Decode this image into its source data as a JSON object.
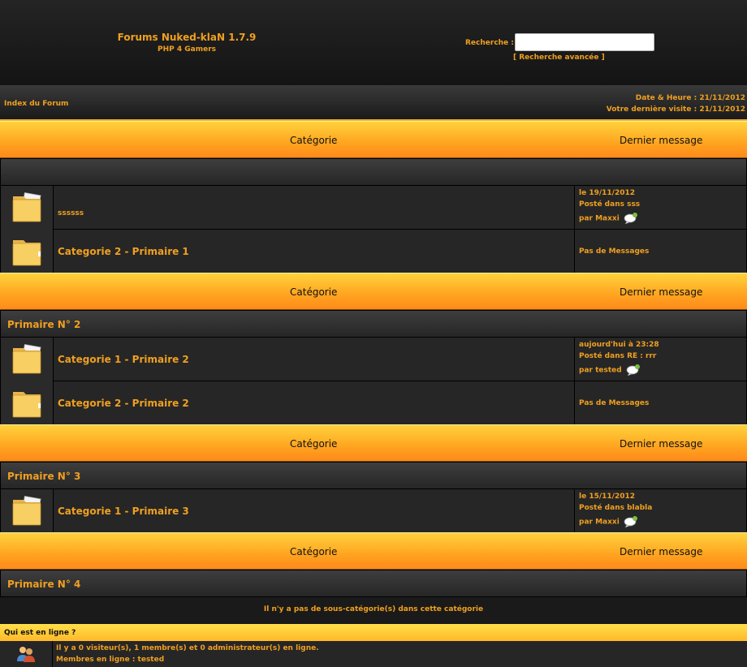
{
  "header": {
    "title": "Forums Nuked-klaN 1.7.9",
    "subtitle": "PHP 4 Gamers",
    "search_label": "Recherche :",
    "search_value": "",
    "advanced_search": "[ Recherche avancée ]"
  },
  "nav": {
    "index": "Index du Forum",
    "date": "Date & Heure : 21/11/2012",
    "last_visit": "Votre dernière visite : 21/11/2012"
  },
  "table_headers": {
    "category": "Catégorie",
    "last_message": "Dernier message"
  },
  "sections": [
    {
      "title": "",
      "forums": [
        {
          "name": "ssssss",
          "last": [
            "le 19/11/2012",
            "Posté dans sss",
            "par Maxxi"
          ],
          "has_bubble": true
        },
        {
          "name": "Categorie 2 - Primaire 1",
          "last": [
            "Pas de Messages"
          ],
          "has_bubble": false
        }
      ]
    },
    {
      "title": "Primaire N° 2",
      "forums": [
        {
          "name": "Categorie 1 - Primaire 2",
          "last": [
            "aujourd'hui à 23:28",
            "Posté dans RE : rrr",
            "par tested"
          ],
          "has_bubble": true
        },
        {
          "name": "Categorie 2 - Primaire 2",
          "last": [
            "Pas de Messages"
          ],
          "has_bubble": false
        }
      ]
    },
    {
      "title": "Primaire N° 3",
      "forums": [
        {
          "name": "Categorie 1 - Primaire 3",
          "last": [
            "le 15/11/2012",
            "Posté dans blabla",
            "par Maxxi"
          ],
          "has_bubble": true
        }
      ]
    },
    {
      "title": "Primaire N° 4",
      "empty_text": "Il n'y a pas de sous-catégorie(s) dans cette catégorie"
    }
  ],
  "online": {
    "title": "Qui est en ligne ?",
    "line1": "Il y a 0 visiteur(s), 1 membre(s) et 0 administrateur(s) en ligne.",
    "line2": "Membres en ligne : tested"
  },
  "colors": {
    "accent": "#f0a020",
    "header_gradient_top": "#ffd23c",
    "header_gradient_bottom": "#ff8a1a",
    "row_bg": "#262626"
  },
  "icons": {
    "forum_folder": "folder-icon",
    "last_post_bubble": "speech-bubble-icon",
    "online_users": "users-icon"
  }
}
